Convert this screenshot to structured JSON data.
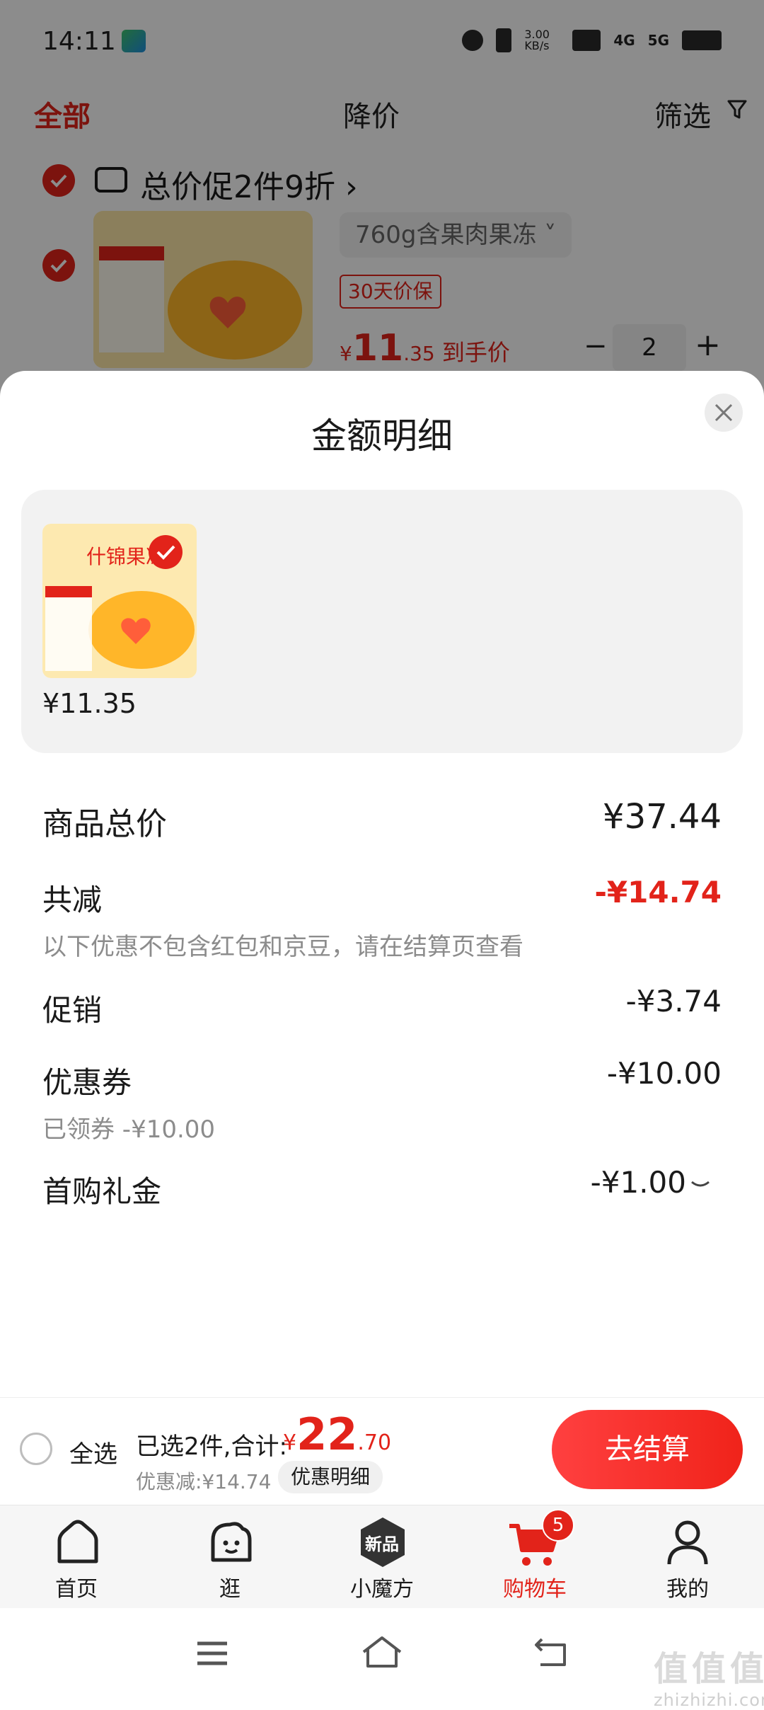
{
  "status_bar": {
    "time": "14:11",
    "net_speed": "3.00 KB/s",
    "network": "4G",
    "network2": "5G"
  },
  "filter_tabs": {
    "all": "全部",
    "price_drop": "降价",
    "filter": "筛选"
  },
  "cart_item": {
    "promo": "总价促2件9折 ›",
    "spec": "760g含果肉果冻 ˅",
    "price_guard": "30天价保",
    "currency": "¥",
    "price_int": "11",
    "price_dec": ".35",
    "price_suffix": " 到手价",
    "qty_minus": "−",
    "quantity": "2",
    "qty_plus": "+"
  },
  "sheet": {
    "title": "金额明细",
    "item_price": "¥11.35",
    "rows": {
      "total_label": "商品总价",
      "total_value": "¥37.44",
      "reduce_label": "共减",
      "reduce_value": "-¥14.74",
      "reduce_note": "以下优惠不包含红包和京豆，请在结算页查看",
      "promo_label": "促销",
      "promo_value": "-¥3.74",
      "coupon_label": "优惠券",
      "coupon_value": "-¥10.00",
      "coupon_note": "已领券 -¥10.00",
      "gift_label": "首购礼金",
      "gift_value": "-¥1.00"
    }
  },
  "checkout": {
    "select_all": "全选",
    "selected_text": "已选2件,合计:",
    "currency": "¥",
    "total_int": "22",
    "total_dec": ".70",
    "discount_text": "优惠减:¥14.74",
    "detail_chip": "优惠明细",
    "button": "去结算"
  },
  "tabbar": {
    "home": "首页",
    "browse": "逛",
    "cube": "小魔方",
    "cube_icon_text": "新品",
    "cart": "购物车",
    "cart_badge": "5",
    "mine": "我的"
  },
  "watermark": {
    "big": "值值值",
    "small": "zhizhizhi.com"
  },
  "colors": {
    "accent": "#e2231a",
    "overlay": "rgba(0,0,0,0.45)"
  }
}
